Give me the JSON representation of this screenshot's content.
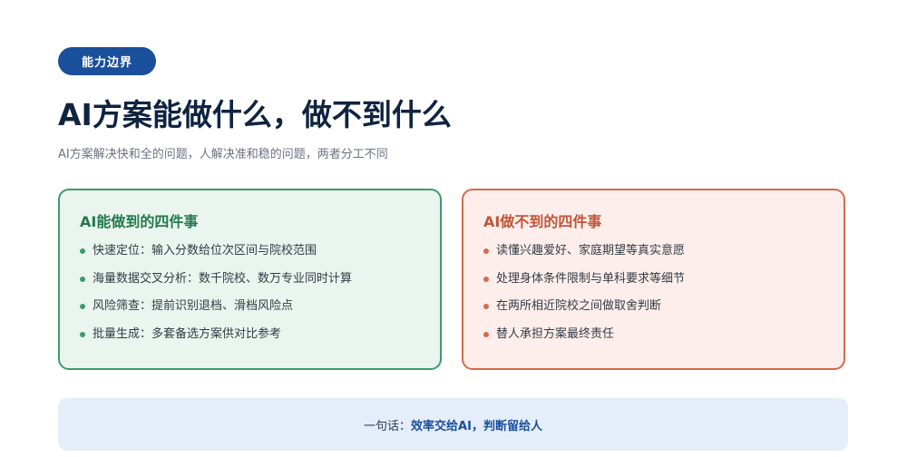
{
  "badge": "能力边界",
  "title": "AI方案能做什么，做不到什么",
  "subtitle": "AI方案解决快和全的问题，人解决准和稳的问题，两者分工不同",
  "can_card": {
    "title": "AI能做到的四件事",
    "items": [
      "快速定位：输入分数给位次区间与院校范围",
      "海量数据交叉分析：数千院校、数万专业同时计算",
      "风险筛查：提前识别退档、滑档风险点",
      "批量生成：多套备选方案供对比参考"
    ]
  },
  "cannot_card": {
    "title": "AI做不到的四件事",
    "items": [
      "读懂兴趣爱好、家庭期望等真实意愿",
      "处理身体条件限制与单科要求等细节",
      "在两所相近院校之间做取舍判断",
      "替人承担方案最终责任"
    ]
  },
  "summary": {
    "lead": "一句话：",
    "emphasis": "效率交给AI，判断留给人"
  },
  "colors": {
    "accent_blue": "#1a4f9c",
    "green": "#3a9d6a",
    "orange": "#d56a4c"
  }
}
